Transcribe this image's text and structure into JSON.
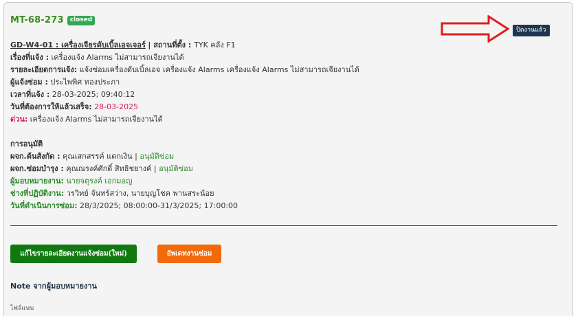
{
  "ticket": {
    "id": "MT-68-273",
    "status": "closed"
  },
  "actions": {
    "close_job": "ปิดงานแล้ว",
    "edit_details": "แก้ไขรายละเอียดงานแจ้งซ่อม(ใหม่)",
    "update_repair": "อัพเดทงานซ่อม"
  },
  "details": {
    "machine_label": "GD-W4-01 : เครื่องเจียรดับเบิ้ลเอจเจอร์",
    "location_label": "สถานที่ตั้ง",
    "location_value": "TYK คลัง F1",
    "subject_label": "เรื่องที่แจ้ง :",
    "subject_value": "เครื่องแจ้ง Alarms ไม่สามารถเจียงานได้",
    "description_label": "รายละเอียดการแจ้ง:",
    "description_value": "แจ้งซ่อมเครื่องดับเบิ้ลเอจ เครื่องแจ้ง Alarms เครื่องแจ้ง Alarms ไม่สามารถเจียงานได้",
    "reporter_label": "ผู้แจ้งซ่อม :",
    "reporter_value": "ประไพพิศ ทองประภา",
    "reported_time_label": "เวลาที่แจ้ง :",
    "reported_time_value": "28-03-2025; 09:40:12",
    "due_date_label": "วันที่ต้องการให้แล้วเสร็จ:",
    "due_date_value": "28-03-2025",
    "urgent_label": "ด่วน:",
    "urgent_value": "เครื่องแจ้ง Alarms ไม่สามารถเจียงานได้"
  },
  "approval": {
    "heading": "การอนุมัติ",
    "supervisor_label": "ผจก.ต้นสังกัด :",
    "supervisor_value": "คุณเสกสรรค์ แตกเงิน",
    "supervisor_status": "อนุมัติซ่อม",
    "maintenance_label": "ผจก.ซ่อมบำรุง :",
    "maintenance_value": "คุณณรงค์ศักดิ์ สิทธิชยางค์",
    "maintenance_status": "อนุมัติซ่อม",
    "assigner_label": "ผู้มอบหมายงาน:",
    "assigner_value": "นายจตุรงค์ เอกมอญ",
    "technician_label": "ช่างที่ปฏิบัติงาน:",
    "technician_value": "วรวิทย์ จันทร์สว่าง, นายบุญโชค พานสระน้อย",
    "repair_date_label": "วันที่ดำเนินการซ่อม:",
    "repair_date_value": "28/3/2025; 08:00:00-31/3/2025; 17:00:00"
  },
  "note": {
    "heading": "Note จากผู้มอบหมายงาน",
    "attachments_label": "ไฟล์แนบ"
  },
  "colors": {
    "arrow": "#e21b1b",
    "ticket_id": "#3c8c1e",
    "status_badge": "#32a852",
    "close_button": "#1e3550",
    "edit_button": "#107a10",
    "update_button": "#f26a0a",
    "due_date": "#d21f4f",
    "approved": "#2d8a2d"
  },
  "icons": {
    "annotation_arrow": "arrow-right-icon"
  }
}
